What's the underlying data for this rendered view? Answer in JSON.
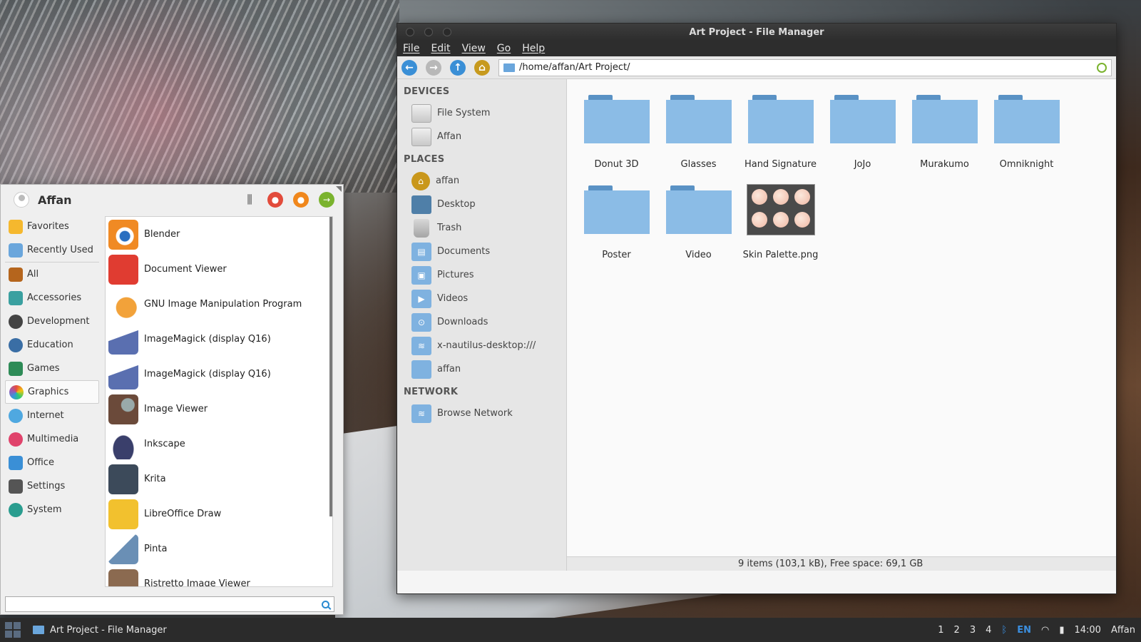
{
  "file_manager": {
    "title": "Art Project - File Manager",
    "menu": [
      "File",
      "Edit",
      "View",
      "Go",
      "Help"
    ],
    "path": "/home/affan/Art Project/",
    "sidebar": {
      "devices_heading": "DEVICES",
      "devices": [
        "File System",
        "Affan"
      ],
      "places_heading": "PLACES",
      "places": [
        {
          "label": "affan",
          "icon": "home-icon"
        },
        {
          "label": "Desktop",
          "icon": "desktop-icon"
        },
        {
          "label": "Trash",
          "icon": "trash-icon"
        },
        {
          "label": "Documents",
          "icon": "documents-folder-icon"
        },
        {
          "label": "Pictures",
          "icon": "pictures-folder-icon"
        },
        {
          "label": "Videos",
          "icon": "videos-folder-icon"
        },
        {
          "label": "Downloads",
          "icon": "downloads-folder-icon"
        },
        {
          "label": "x-nautilus-desktop:///",
          "icon": "network-folder-icon"
        },
        {
          "label": "affan",
          "icon": "folder-icon"
        }
      ],
      "network_heading": "NETWORK",
      "network": [
        "Browse Network"
      ]
    },
    "items": [
      {
        "label": "Donut 3D",
        "type": "folder"
      },
      {
        "label": "Glasses",
        "type": "folder"
      },
      {
        "label": "Hand Signature",
        "type": "folder"
      },
      {
        "label": "JoJo",
        "type": "folder"
      },
      {
        "label": "Murakumo",
        "type": "folder"
      },
      {
        "label": "Omniknight",
        "type": "folder"
      },
      {
        "label": "Poster",
        "type": "folder"
      },
      {
        "label": "Video",
        "type": "folder"
      },
      {
        "label": "Skin Palette.png",
        "type": "image"
      }
    ],
    "status": "9 items (103,1 kB), Free space: 69,1 GB"
  },
  "app_menu": {
    "user": "Affan",
    "categories": [
      {
        "label": "Favorites",
        "color": "#f5b82e"
      },
      {
        "label": "Recently Used",
        "color": "#6aa6dc"
      },
      {
        "label": "All",
        "color": "#b5651d"
      },
      {
        "label": "Accessories",
        "color": "#3aa0a0"
      },
      {
        "label": "Development",
        "color": "#444444"
      },
      {
        "label": "Education",
        "color": "#3a6ea5"
      },
      {
        "label": "Games",
        "color": "#2e8b57"
      },
      {
        "label": "Graphics",
        "color": "#d94f9f"
      },
      {
        "label": "Internet",
        "color": "#4fa8e0"
      },
      {
        "label": "Multimedia",
        "color": "#e0436b"
      },
      {
        "label": "Office",
        "color": "#3a8fd6"
      },
      {
        "label": "Settings",
        "color": "#555555"
      },
      {
        "label": "System",
        "color": "#2a9d8f"
      }
    ],
    "apps": [
      {
        "label": "Blender",
        "color": "#f08a24"
      },
      {
        "label": "Document Viewer",
        "color": "#e03c31"
      },
      {
        "label": "GNU Image Manipulation Program",
        "color": "#f2a23a"
      },
      {
        "label": "ImageMagick (display Q16)",
        "color": "#5a6fb0"
      },
      {
        "label": "ImageMagick (display Q16)",
        "color": "#5a6fb0"
      },
      {
        "label": "Image Viewer",
        "color": "#a0522d"
      },
      {
        "label": "Inkscape",
        "color": "#3a3f6b"
      },
      {
        "label": "Krita",
        "color": "#3c4a5a"
      },
      {
        "label": "LibreOffice Draw",
        "color": "#f2c12e"
      },
      {
        "label": "Pinta",
        "color": "#6a8fb5"
      },
      {
        "label": "Ristretto Image Viewer",
        "color": "#8b6a50"
      }
    ],
    "search_value": ""
  },
  "taskbar": {
    "task": "Art Project - File Manager",
    "workspaces": [
      "1",
      "2",
      "3",
      "4"
    ],
    "lang": "EN",
    "time": "14:00",
    "user": "Affan"
  }
}
